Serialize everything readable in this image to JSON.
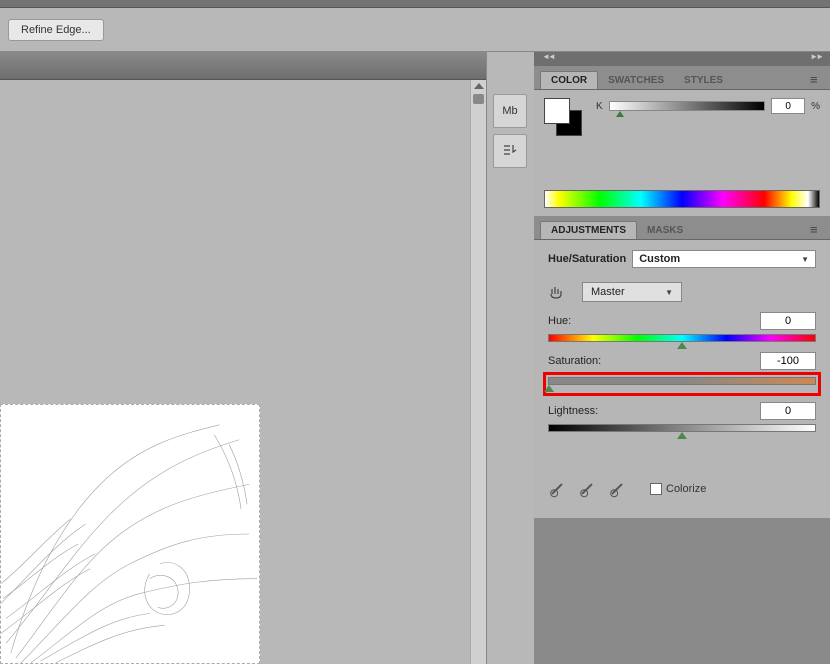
{
  "options_bar": {
    "refine_edge": "Refine Edge..."
  },
  "icon_strip": {
    "mb": "Mb"
  },
  "color_panel": {
    "tabs": [
      "COLOR",
      "SWATCHES",
      "STYLES"
    ],
    "channel": "K",
    "value": "0",
    "unit": "%"
  },
  "adjust_panel": {
    "tabs": [
      "ADJUSTMENTS",
      "MASKS"
    ],
    "title": "Hue/Saturation",
    "preset": "Custom",
    "range": "Master",
    "hue": {
      "label": "Hue:",
      "value": "0"
    },
    "saturation": {
      "label": "Saturation:",
      "value": "-100"
    },
    "lightness": {
      "label": "Lightness:",
      "value": "0"
    },
    "colorize": "Colorize"
  }
}
